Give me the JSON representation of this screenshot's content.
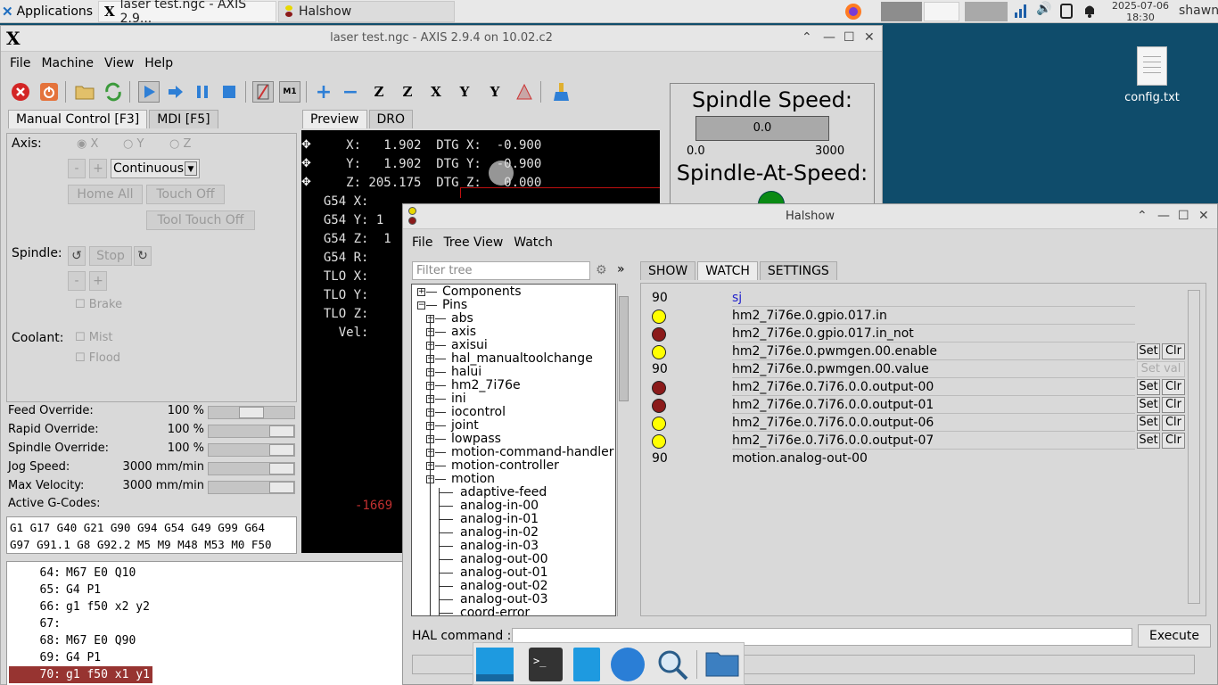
{
  "taskbar": {
    "apps_label": "Applications",
    "task_axis": "laser test.ngc - AXIS 2.9...",
    "task_halshow": "Halshow",
    "clock_date": "2025-07-06",
    "clock_time": "18:30",
    "user": "shawn"
  },
  "desktop": {
    "icon_label": "config.txt"
  },
  "axis": {
    "title": "laser test.ngc - AXIS 2.9.4 on 10.02.c2",
    "menu": {
      "file": "File",
      "machine": "Machine",
      "view": "View",
      "help": "Help"
    },
    "left_tabs": {
      "manual": "Manual Control [F3]",
      "mdi": "MDI [F5]"
    },
    "axis_label": "Axis:",
    "axes": [
      "X",
      "Y",
      "Z"
    ],
    "minus": "-",
    "plus": "+",
    "jog_mode": "Continuous",
    "home_all": "Home All",
    "touch_off": "Touch Off",
    "tool_touch_off": "Tool Touch Off",
    "spindle_label": "Spindle:",
    "stop": "Stop",
    "brake": "Brake",
    "coolant_label": "Coolant:",
    "mist": "Mist",
    "flood": "Flood",
    "overrides": [
      {
        "name": "Feed Override:",
        "value": "100 %",
        "level": 0.5
      },
      {
        "name": "Rapid Override:",
        "value": "100 %",
        "level": 1.0
      },
      {
        "name": "Spindle Override:",
        "value": "100 %",
        "level": 1.0
      },
      {
        "name": "Jog Speed:",
        "value": "3000 mm/min",
        "level": 1.0
      },
      {
        "name": "Max Velocity:",
        "value": "3000 mm/min",
        "level": 1.0
      }
    ],
    "active_gcodes_label": "Active G-Codes:",
    "active_gcodes": "G1 G17 G40 G21 G90 G94 G54 G49 G99 G64\nG97 G91.1 G8 G92.2 M5 M9 M48 M53 M0 F50",
    "preview_tabs": {
      "preview": "Preview",
      "dro": "DRO"
    },
    "dro": [
      "     X:   1.902  DTG X:  -0.900",
      "     Y:   1.902  DTG Y:  -0.900",
      "     Z: 205.175  DTG Z:   0.000",
      "  G54 X:  ",
      "  G54 Y: 1",
      "  G54 Z:  1",
      "  G54 R:",
      "  TLO X:",
      "  TLO Y:",
      "  TLO Z:",
      "    Vel:"
    ],
    "preview_coord": "-1669",
    "spindle_speed_title": "Spindle Speed:",
    "spindle_speed_value": "0.0",
    "spindle_scale_min": "0.0",
    "spindle_scale_max": "3000",
    "spindle_at_speed_title": "Spindle-At-Speed:",
    "program": [
      {
        "no": "64:",
        "code": "M67 E0 Q10"
      },
      {
        "no": "65:",
        "code": "G4 P1"
      },
      {
        "no": "66:",
        "code": "g1 f50 x2 y2"
      },
      {
        "no": "67:",
        "code": ""
      },
      {
        "no": "68:",
        "code": "M67 E0 Q90"
      },
      {
        "no": "69:",
        "code": "G4 P1"
      },
      {
        "no": "70:",
        "code": "g1 f50 x1 y1"
      }
    ]
  },
  "halshow": {
    "title": "Halshow",
    "menu": {
      "file": "File",
      "tree_view": "Tree View",
      "watch": "Watch"
    },
    "filter_placeholder": "Filter tree",
    "expand_glyph": "»",
    "tabs": {
      "show": "SHOW",
      "watch": "WATCH",
      "settings": "SETTINGS"
    },
    "tree_top": [
      "Components",
      "Pins"
    ],
    "tree_pins": [
      "abs",
      "axis",
      "axisui",
      "hal_manualtoolchange",
      "halui",
      "hm2_7i76e",
      "ini",
      "iocontrol",
      "joint",
      "lowpass",
      "motion-command-handler",
      "motion-controller",
      "motion"
    ],
    "tree_motion": [
      "adaptive-feed",
      "analog-in-00",
      "analog-in-01",
      "analog-in-02",
      "analog-in-03",
      "analog-out-00",
      "analog-out-01",
      "analog-out-02",
      "analog-out-03",
      "coord-error"
    ],
    "watch": [
      {
        "kind": "num",
        "value": "90",
        "name": "sj",
        "link": true
      },
      {
        "kind": "led",
        "color": "#ffff00",
        "name": "hm2_7i76e.0.gpio.017.in"
      },
      {
        "kind": "led",
        "color": "#8b1a1a",
        "name": "hm2_7i76e.0.gpio.017.in_not"
      },
      {
        "kind": "led",
        "color": "#ffff00",
        "name": "hm2_7i76e.0.pwmgen.00.enable",
        "setclr": true
      },
      {
        "kind": "num",
        "value": "90",
        "name": "hm2_7i76e.0.pwmgen.00.value",
        "setval": true
      },
      {
        "kind": "led",
        "color": "#8b1a1a",
        "name": "hm2_7i76e.0.7i76.0.0.output-00",
        "setclr": true
      },
      {
        "kind": "led",
        "color": "#8b1a1a",
        "name": "hm2_7i76e.0.7i76.0.0.output-01",
        "setclr": true
      },
      {
        "kind": "led",
        "color": "#ffff00",
        "name": "hm2_7i76e.0.7i76.0.0.output-06",
        "setclr": true
      },
      {
        "kind": "led",
        "color": "#ffff00",
        "name": "hm2_7i76e.0.7i76.0.0.output-07",
        "setclr": true
      },
      {
        "kind": "num",
        "value": "90",
        "name": "motion.analog-out-00"
      }
    ],
    "set_label": "Set",
    "clr_label": "Clr",
    "set_val_label": "Set val",
    "hal_command_label": "HAL command :",
    "execute": "Execute"
  }
}
